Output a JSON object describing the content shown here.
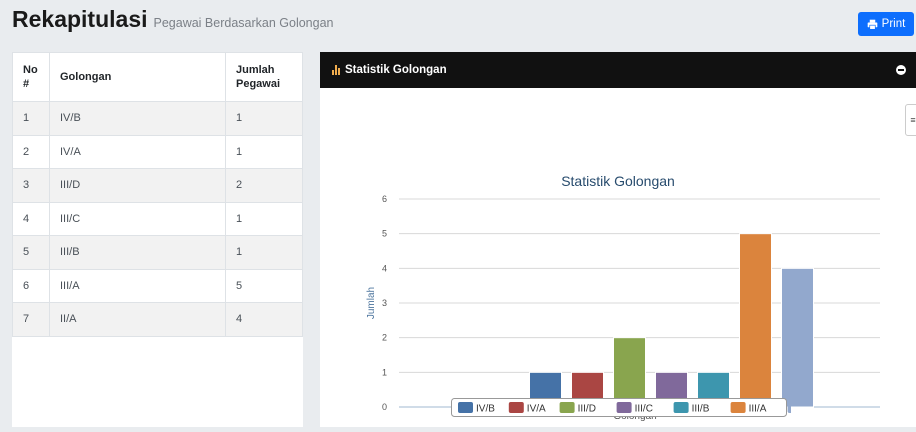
{
  "header": {
    "title": "Rekapitulasi",
    "subtitle": "Pegawai Berdasarkan Golongan",
    "print_label": "Print"
  },
  "table": {
    "headers": {
      "no": "No #",
      "golongan": "Golongan",
      "jumlah": "Jumlah Pegawai"
    },
    "rows": [
      {
        "no": "1",
        "golongan": "IV/B",
        "jumlah": "1"
      },
      {
        "no": "2",
        "golongan": "IV/A",
        "jumlah": "1"
      },
      {
        "no": "3",
        "golongan": "III/D",
        "jumlah": "2"
      },
      {
        "no": "4",
        "golongan": "III/C",
        "jumlah": "1"
      },
      {
        "no": "5",
        "golongan": "III/B",
        "jumlah": "1"
      },
      {
        "no": "6",
        "golongan": "III/A",
        "jumlah": "5"
      },
      {
        "no": "7",
        "golongan": "II/A",
        "jumlah": "4"
      }
    ]
  },
  "panel": {
    "title": "Statistik Golongan",
    "side_tab": "≡"
  },
  "chart_data": {
    "type": "bar",
    "title": "Statistik Golongan",
    "xlabel": "Golongan",
    "ylabel": "Jumlah",
    "ylim": [
      0,
      6
    ],
    "yticks": [
      0,
      1,
      2,
      3,
      4,
      5,
      6
    ],
    "grid": true,
    "legend_position": "bottom",
    "series": [
      {
        "name": "IV/B",
        "value": 1,
        "color": "#4572a7"
      },
      {
        "name": "IV/A",
        "value": 1,
        "color": "#aa4643"
      },
      {
        "name": "III/D",
        "value": 2,
        "color": "#89a54e"
      },
      {
        "name": "III/C",
        "value": 1,
        "color": "#80699b"
      },
      {
        "name": "III/B",
        "value": 1,
        "color": "#3d96ae"
      },
      {
        "name": "III/A",
        "value": 5,
        "color": "#db843d"
      },
      {
        "name": "II/A",
        "value": 4,
        "color": "#92a8cd"
      }
    ]
  }
}
